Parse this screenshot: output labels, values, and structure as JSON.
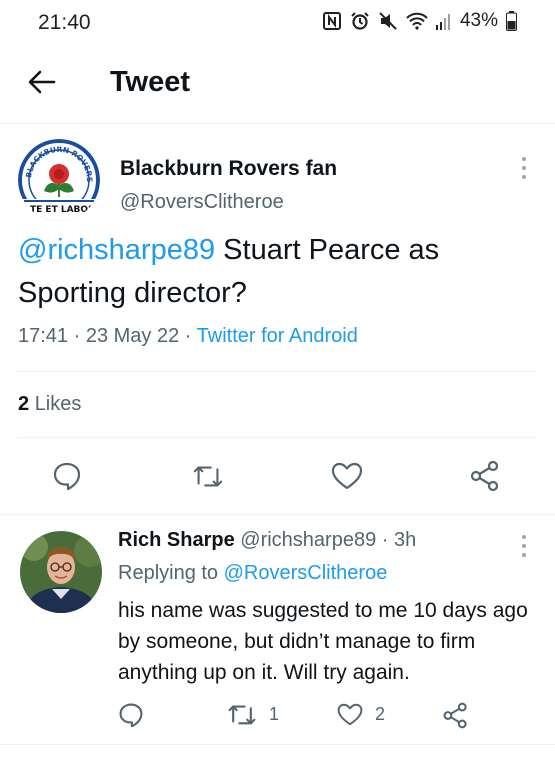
{
  "status_bar": {
    "time": "21:40",
    "battery_percent": "43%",
    "icons": [
      "nfc-icon",
      "alarm-icon",
      "mute-icon",
      "wifi-icon",
      "signal-icon",
      "battery-icon"
    ]
  },
  "header": {
    "back_icon": "arrow-left-icon",
    "title": "Tweet"
  },
  "tweet": {
    "author_name": "Blackburn Rovers fan",
    "author_handle": "@RoversClitheroe",
    "avatar_icon": "blackburn-rovers-crest",
    "crest_text_top": "BLACKBURN ROVERS F.C",
    "crest_motto": "TE ET LABORE",
    "mention": "@richsharpe89",
    "text": " Stuart Pearce as Sporting director?",
    "time": "17:41",
    "separator": " · ",
    "date": "23 May 22",
    "source": "Twitter for Android",
    "likes_count": "2",
    "likes_label": "Likes",
    "actions": [
      "reply-icon",
      "retweet-icon",
      "like-icon",
      "share-icon"
    ]
  },
  "reply": {
    "author_name": "Rich Sharpe",
    "author_handle": "@richsharpe89",
    "time_ago": "3h",
    "separator": " · ",
    "replying_to_label": "Replying to ",
    "replying_to_handle": "@RoversClitheroe",
    "text": "his name was suggested to me 10 days ago by someone, but didn’t manage to firm anything up on it. Will try again.",
    "retweet_count": "1",
    "like_count": "2"
  },
  "colors": {
    "accent": "#1d9bf0",
    "text": "#0f1419",
    "muted": "#536471",
    "icon": "#536471",
    "divider": "#eff3f4"
  }
}
